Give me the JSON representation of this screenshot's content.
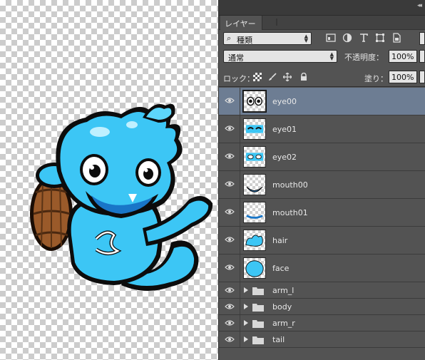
{
  "panel": {
    "tab_label": "レイヤー",
    "filter_value": "種類",
    "blend_mode": "通常",
    "opacity_label": "不透明度：",
    "opacity_value": "100%",
    "lock_label": "ロック：",
    "fill_label": "塗り：",
    "fill_value": "100%"
  },
  "layers": [
    {
      "name": "eye00",
      "kind": "layer",
      "selected": true
    },
    {
      "name": "eye01",
      "kind": "layer",
      "selected": false
    },
    {
      "name": "eye02",
      "kind": "layer",
      "selected": false
    },
    {
      "name": "mouth00",
      "kind": "layer",
      "selected": false
    },
    {
      "name": "mouth01",
      "kind": "layer",
      "selected": false
    },
    {
      "name": "hair",
      "kind": "layer",
      "selected": false
    },
    {
      "name": "face",
      "kind": "layer",
      "selected": false
    },
    {
      "name": "arm_l",
      "kind": "group",
      "selected": false
    },
    {
      "name": "body",
      "kind": "group",
      "selected": false
    },
    {
      "name": "arm_r",
      "kind": "group",
      "selected": false
    },
    {
      "name": "tail",
      "kind": "group",
      "selected": false
    }
  ],
  "colors": {
    "panel_bg": "#535353",
    "selected_row": "#6d7d93",
    "character_blue": "#3cc6f5"
  }
}
